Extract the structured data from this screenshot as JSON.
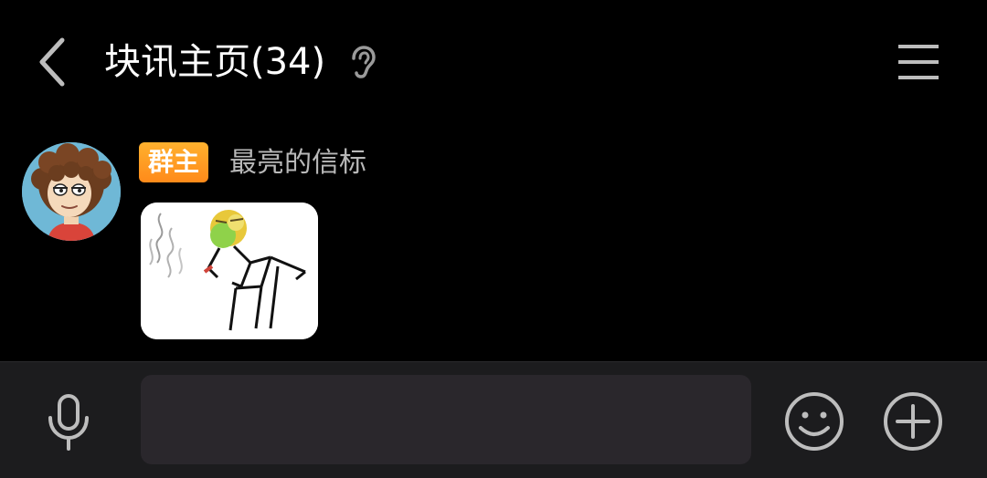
{
  "header": {
    "title": "块讯主页(34)",
    "back_icon": "chevron-left-icon",
    "ear_icon": "ear-icon",
    "menu_icon": "hamburger-menu-icon"
  },
  "message": {
    "badge": "群主",
    "sender": "最亮的信标",
    "avatar": "cartoon-avatar",
    "content": "sticker-image"
  },
  "input_bar": {
    "mic_icon": "microphone-icon",
    "input_value": "",
    "input_placeholder": "",
    "emoji_icon": "smiley-icon",
    "plus_icon": "plus-circle-icon"
  },
  "colors": {
    "background": "#000000",
    "bar_background": "#1c1c1e",
    "input_background": "#2a272c",
    "badge_orange": "#ff9c22",
    "icon_gray": "#bdbdbd"
  }
}
